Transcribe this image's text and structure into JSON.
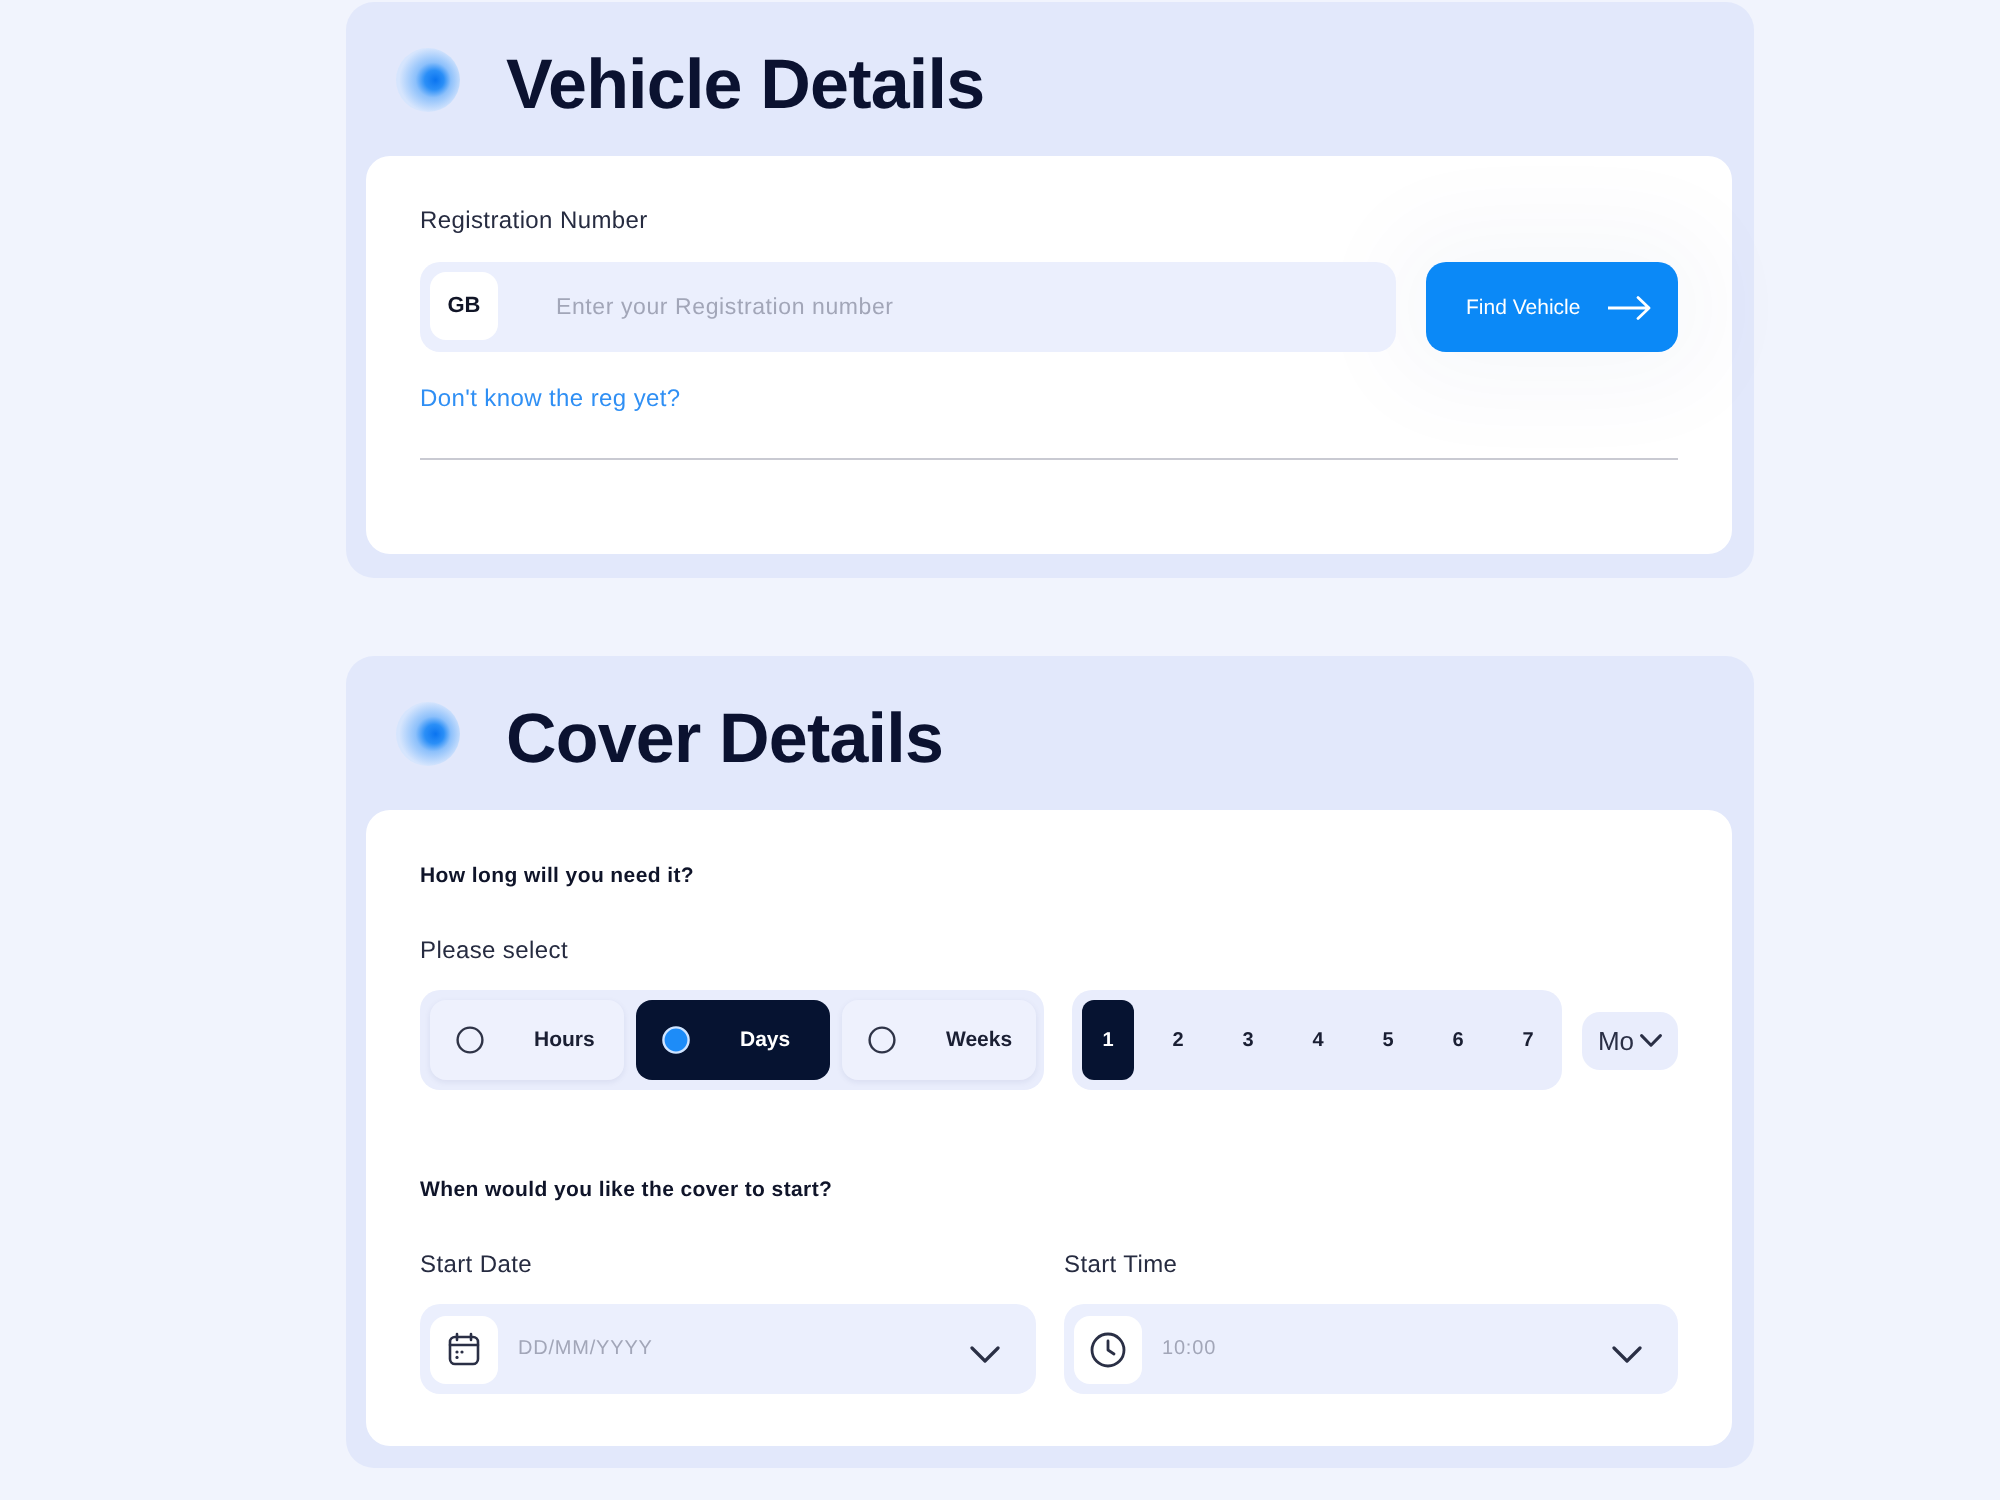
{
  "vehicle_details": {
    "title": "Vehicle Details",
    "registration": {
      "label": "Registration Number",
      "prefix": "GB",
      "placeholder": "Enter your Registration number"
    },
    "find_button": {
      "label": "Find Vehicle"
    },
    "help_link": "Don't know the reg yet?"
  },
  "cover_details": {
    "title": "Cover Details",
    "duration_question": "How long will you need it?",
    "select_label": "Please select",
    "units": [
      {
        "label": "Hours",
        "selected": false
      },
      {
        "label": "Days",
        "selected": true
      },
      {
        "label": "Weeks",
        "selected": false
      }
    ],
    "counts": [
      {
        "label": "1",
        "selected": true
      },
      {
        "label": "2",
        "selected": false
      },
      {
        "label": "3",
        "selected": false
      },
      {
        "label": "4",
        "selected": false
      },
      {
        "label": "5",
        "selected": false
      },
      {
        "label": "6",
        "selected": false
      },
      {
        "label": "7",
        "selected": false
      }
    ],
    "unit_dropdown": {
      "value": "Mo"
    },
    "start_question": "When would you like the cover to start?",
    "start_date": {
      "label": "Start Date",
      "placeholder": "DD/MM/YYYY"
    },
    "start_time": {
      "label": "Start Time",
      "placeholder": "10:00"
    }
  }
}
